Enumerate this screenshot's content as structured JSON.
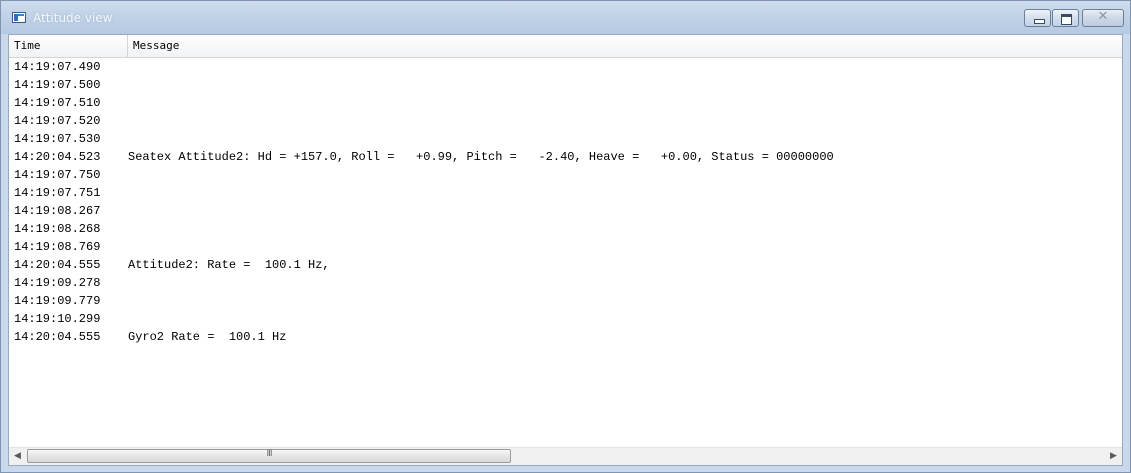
{
  "window": {
    "title": "Attitude view",
    "controls": {
      "minimize_icon": "minimize-icon",
      "maximize_icon": "maximize-icon",
      "close_icon": "close-icon",
      "close_glyph": "✕"
    }
  },
  "table": {
    "columns": {
      "time": "Time",
      "message": "Message"
    },
    "rows": [
      {
        "time": "14:19:07.490",
        "message": ""
      },
      {
        "time": "14:19:07.500",
        "message": ""
      },
      {
        "time": "14:19:07.510",
        "message": ""
      },
      {
        "time": "14:19:07.520",
        "message": ""
      },
      {
        "time": "14:19:07.530",
        "message": ""
      },
      {
        "time": "14:20:04.523",
        "message": "Seatex Attitude2: Hd = +157.0, Roll =   +0.99, Pitch =   -2.40, Heave =   +0.00, Status = 00000000"
      },
      {
        "time": "14:19:07.750",
        "message": ""
      },
      {
        "time": "14:19:07.751",
        "message": ""
      },
      {
        "time": "14:19:08.267",
        "message": ""
      },
      {
        "time": "14:19:08.268",
        "message": ""
      },
      {
        "time": "14:19:08.769",
        "message": ""
      },
      {
        "time": "14:20:04.555",
        "message": "Attitude2: Rate =  100.1 Hz,"
      },
      {
        "time": "14:19:09.278",
        "message": ""
      },
      {
        "time": "14:19:09.779",
        "message": ""
      },
      {
        "time": "14:19:10.299",
        "message": ""
      },
      {
        "time": "14:20:04.555",
        "message": "Gyro2 Rate =  100.1 Hz"
      }
    ]
  },
  "scrollbar": {
    "left_arrow": "◀",
    "right_arrow": "▶",
    "grip": "III"
  },
  "colors": {
    "titlebar": "#bfd1e6",
    "frame": "#c9d8ea",
    "title_text": "#f4f8fc"
  }
}
